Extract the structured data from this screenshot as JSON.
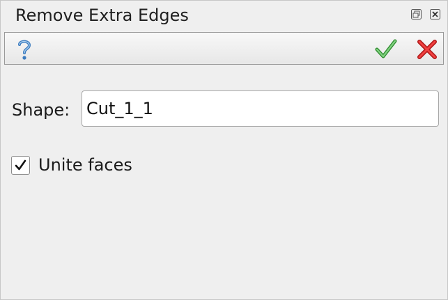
{
  "window": {
    "title": "Remove Extra Edges",
    "float_icon": "float-icon",
    "close_icon": "close-icon"
  },
  "toolbar": {
    "help_icon": "help-icon",
    "apply_icon": "checkmark-icon",
    "cancel_icon": "cross-icon",
    "apply_color": "#4caf50",
    "cancel_color": "#e02020",
    "help_color": "#3b7bbf"
  },
  "form": {
    "shape_label": "Shape:",
    "shape_value": "Cut_1_1",
    "unite_faces_label": "Unite faces",
    "unite_faces_checked": true
  }
}
